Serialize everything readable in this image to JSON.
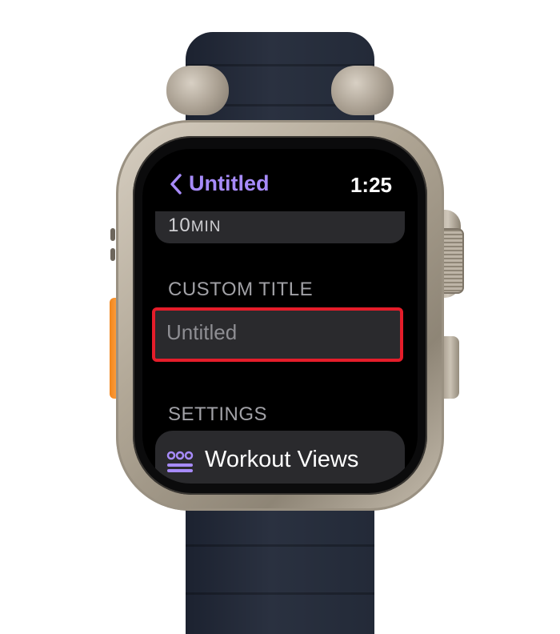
{
  "header": {
    "back_label": "Untitled",
    "time": "1:25"
  },
  "duration": {
    "value": "10",
    "unit": "MIN"
  },
  "custom_title": {
    "section_label": "CUSTOM TITLE",
    "placeholder": "Untitled"
  },
  "settings": {
    "section_label": "SETTINGS",
    "workout_views_label": "Workout Views"
  },
  "colors": {
    "accent": "#a78bfa",
    "highlight_border": "#e51d2a",
    "field_background": "#2a2a2d"
  },
  "icons": {
    "back": "chevron-left-icon",
    "workout_views": "workout-views-icon"
  }
}
